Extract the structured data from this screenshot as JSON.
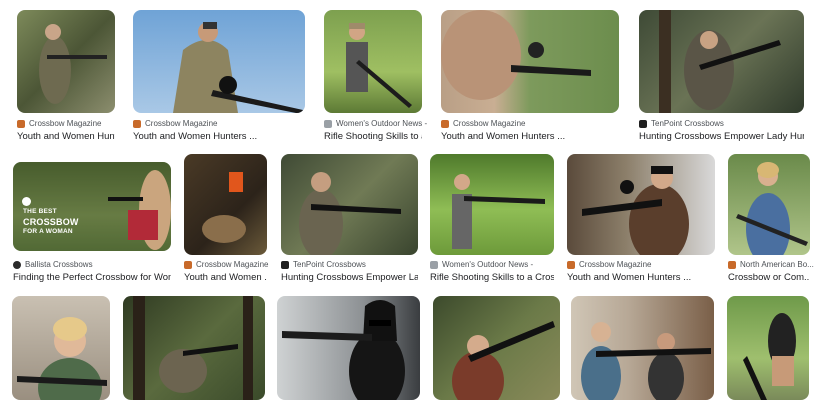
{
  "results": [
    {
      "source": "Crossbow Magazine",
      "title": "Youth and Women Hunter ...",
      "favicon": "crossbow-magazine-icon",
      "fav_color": "#c86a2a"
    },
    {
      "source": "Crossbow Magazine",
      "title": "Youth and Women Hunters ...",
      "favicon": "crossbow-magazine-icon",
      "fav_color": "#c86a2a"
    },
    {
      "source": "Women's Outdoor News -",
      "title": "Rifle Shooting Skills to a ...",
      "favicon": "womens-outdoor-news-icon",
      "fav_color": "#9aa0a6"
    },
    {
      "source": "Crossbow Magazine",
      "title": "Youth and Women Hunters ...",
      "favicon": "crossbow-magazine-icon",
      "fav_color": "#c86a2a"
    },
    {
      "source": "TenPoint Crossbows",
      "title": "Hunting Crossbows Empower Lady Hunter...",
      "favicon": "tenpoint-icon",
      "fav_color": "#1f1f1f"
    },
    {
      "source": "Ballista Crossbows",
      "title": "Finding the Perfect Crossbow for Wom...",
      "favicon": "ballista-icon",
      "fav_color": "#2b2b2b",
      "overlay": [
        "THE BEST",
        "CROSSBOW",
        "FOR A WOMAN"
      ]
    },
    {
      "source": "Crossbow Magazine",
      "title": "Youth and Women ...",
      "favicon": "crossbow-magazine-icon",
      "fav_color": "#c86a2a"
    },
    {
      "source": "TenPoint Crossbows",
      "title": "Hunting Crossbows Empower Lad...",
      "favicon": "tenpoint-icon",
      "fav_color": "#1f1f1f"
    },
    {
      "source": "Women's Outdoor News -",
      "title": "Rifle Shooting Skills to a Cros...",
      "favicon": "womens-outdoor-news-icon",
      "fav_color": "#9aa0a6"
    },
    {
      "source": "Crossbow Magazine",
      "title": "Youth and Women Hunters ...",
      "favicon": "crossbow-magazine-icon",
      "fav_color": "#c86a2a"
    },
    {
      "source": "North American Bo...",
      "title": "Crossbow or Com...",
      "favicon": "north-american-bowhunter-icon",
      "fav_color": "#c86a2a"
    },
    {
      "source": "",
      "title": ""
    },
    {
      "source": "",
      "title": ""
    },
    {
      "source": "",
      "title": ""
    },
    {
      "source": "",
      "title": ""
    },
    {
      "source": "",
      "title": ""
    },
    {
      "source": "",
      "title": ""
    }
  ]
}
